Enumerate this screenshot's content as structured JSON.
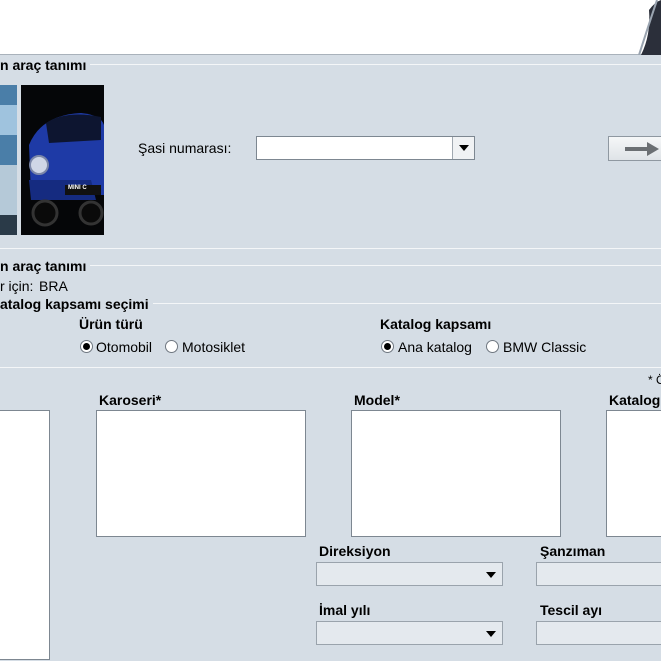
{
  "section_vin": {
    "title": "n araç tanımı",
    "vin_label": "Şasi numarası:",
    "vin_value": ""
  },
  "section_vehicle": {
    "title": "n araç tanımı",
    "market_label": "r için:",
    "market_value": "BRA"
  },
  "section_catalog": {
    "title": "atalog kapsamı seçimi",
    "product_type": {
      "label": "Ürün türü",
      "options": [
        "Otomobil",
        "Motosiklet"
      ],
      "selected": "Otomobil"
    },
    "catalog_scope": {
      "label": "Katalog kapsamı",
      "options": [
        "Ana katalog",
        "BMW Classic"
      ],
      "selected": "Ana katalog"
    }
  },
  "filters": {
    "required_note": "* Ö",
    "body_label": "Karoseri*",
    "model_label": "Model*",
    "catalog_label": "Katalog",
    "steering_label": "Direksiyon",
    "transmission_label": "Şanzıman",
    "production_year_label": "İmal yılı",
    "registration_month_label": "Tescil ayı"
  },
  "images": {
    "car_badge_text": "MINI C"
  },
  "colors": {
    "background": "#d5dde5",
    "car_blue": "#1e3aa6"
  },
  "icons": {
    "go": "arrow-right-icon",
    "dropdown": "chevron-down-icon"
  }
}
